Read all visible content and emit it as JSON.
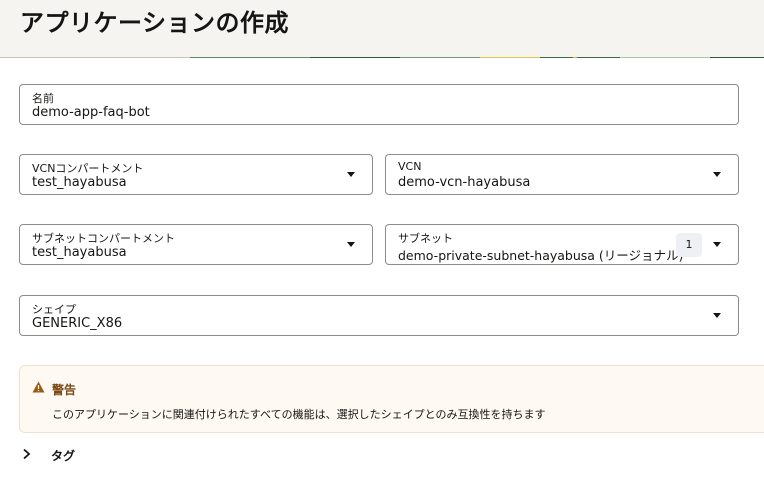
{
  "page": {
    "title": "アプリケーションの作成"
  },
  "form": {
    "name": {
      "label": "名前",
      "value": "demo-app-faq-bot"
    },
    "vcn_compartment": {
      "label": "VCNコンパートメント",
      "value": "test_hayabusa"
    },
    "vcn": {
      "label": "VCN",
      "value": "demo-vcn-hayabusa"
    },
    "subnet_compartment": {
      "label": "サブネットコンパートメント",
      "value": "test_hayabusa"
    },
    "subnet": {
      "label": "サブネット",
      "value": "demo-private-subnet-hayabusa (リージョナル)",
      "count": "1"
    },
    "shape": {
      "label": "シェイプ",
      "value": "GENERIC_X86"
    }
  },
  "warning": {
    "icon": "warning-triangle-icon",
    "title": "警告",
    "message": "このアプリケーションに関連付けられたすべての機能は、選択したシェイプとのみ互換性を持ちます"
  },
  "tags": {
    "icon": "chevron-right-icon",
    "label": "タグ"
  },
  "colors": {
    "header_bg": "#f6f4f1",
    "warning_bg": "#fef9f2",
    "warning_title": "#7a4a14",
    "border": "#8f8c88"
  }
}
